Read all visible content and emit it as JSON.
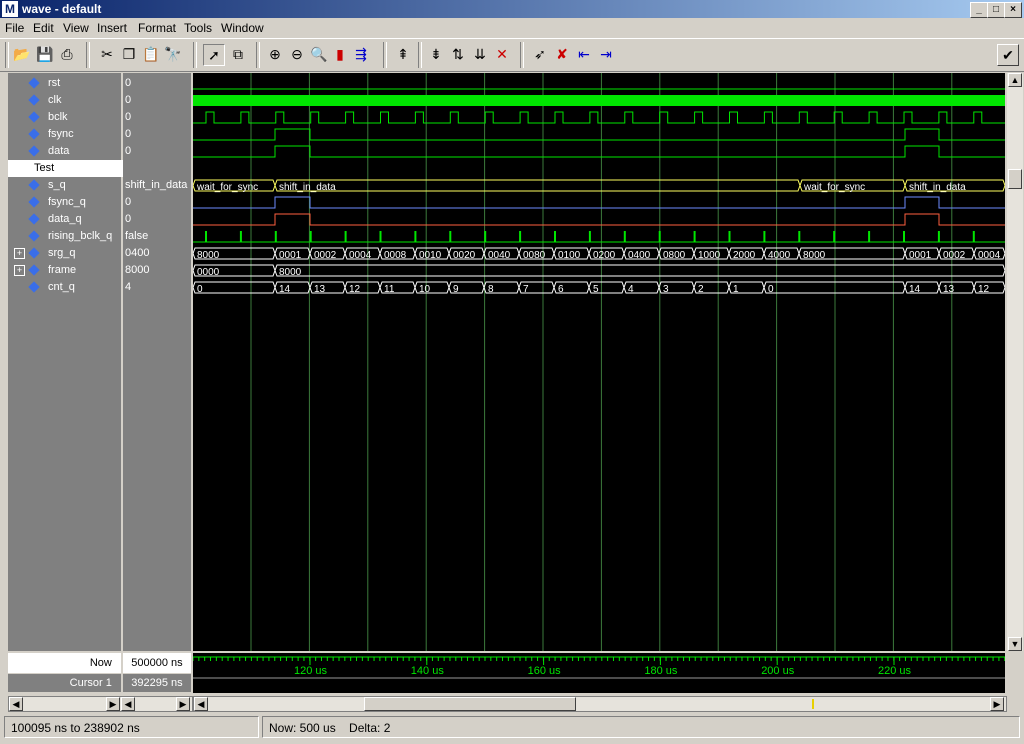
{
  "window": {
    "title": "wave - default",
    "app_icon": "M"
  },
  "menu": [
    "File",
    "Edit",
    "View",
    "Insert",
    "Format",
    "Tools",
    "Window"
  ],
  "toolbar_icons": [
    "open-folder-icon",
    "save-icon",
    "print-icon",
    "cut-icon",
    "copy-icon",
    "paste-icon",
    "find-icon",
    "select-arrow-icon",
    "zoom-region-icon",
    "zoom-in-icon",
    "zoom-out-icon",
    "zoom-full-icon",
    "break-icon",
    "step-icon",
    "insert-cursor-icon",
    "move-cursor-up-icon",
    "move-cursor-down-icon",
    "delete-cursor-icon",
    "edge-select-icon",
    "edge-delete-icon",
    "edge-prev-icon",
    "edge-next-icon",
    "dock-icon"
  ],
  "signals": [
    {
      "name": "rst",
      "value": "0",
      "type": "bit"
    },
    {
      "name": "clk",
      "value": "0",
      "type": "clk"
    },
    {
      "name": "bclk",
      "value": "0",
      "type": "bclk"
    },
    {
      "name": "fsync",
      "value": "0",
      "type": "bit"
    },
    {
      "name": "data",
      "value": "0",
      "type": "bit"
    },
    {
      "name": "Test",
      "value": "",
      "type": "divider"
    },
    {
      "name": "s_q",
      "value": "shift_in_data",
      "type": "bus"
    },
    {
      "name": "fsync_q",
      "value": "0",
      "type": "bit"
    },
    {
      "name": "data_q",
      "value": "0",
      "type": "bit"
    },
    {
      "name": "rising_bclk_q",
      "value": "false",
      "type": "bool"
    },
    {
      "name": "srg_q",
      "value": "0400",
      "type": "bus",
      "expandable": true
    },
    {
      "name": "frame",
      "value": "8000",
      "type": "bus",
      "expandable": true
    },
    {
      "name": "cnt_q",
      "value": "4",
      "type": "bus"
    }
  ],
  "bus_values": {
    "s_q": [
      "wait_for_sync",
      "shift_in_data",
      "wait_for_sync",
      "shift_in_data"
    ],
    "srg_q": [
      "8000",
      "0001",
      "0002",
      "0004",
      "0008",
      "0010",
      "0020",
      "0040",
      "0080",
      "0100",
      "0200",
      "0400",
      "0800",
      "1000",
      "2000",
      "4000",
      "8000",
      "0001",
      "0002",
      "0004"
    ],
    "frame": [
      "0000",
      "8000"
    ],
    "cnt_q": [
      "0",
      "14",
      "13",
      "12",
      "11",
      "10",
      "9",
      "8",
      "7",
      "6",
      "5",
      "4",
      "3",
      "2",
      "1",
      "0",
      "14",
      "13",
      "12"
    ]
  },
  "now": {
    "label": "Now",
    "value": "500000 ns"
  },
  "cursor": {
    "label": "Cursor 1",
    "value": "392295 ns"
  },
  "timeline_labels": [
    "120 us",
    "140 us",
    "160 us",
    "180 us",
    "200 us",
    "220 us"
  ],
  "status": {
    "range": "100095 ns to 238902 ns",
    "now": "Now: 500 us",
    "delta": "Delta: 2"
  },
  "colors": {
    "wave": "#00e600",
    "bus": "#ffff60",
    "fsync_q": "#6e8cff",
    "data_q": "#ff6040",
    "grid": "#3c7a3c",
    "marker": "#ffff60"
  }
}
